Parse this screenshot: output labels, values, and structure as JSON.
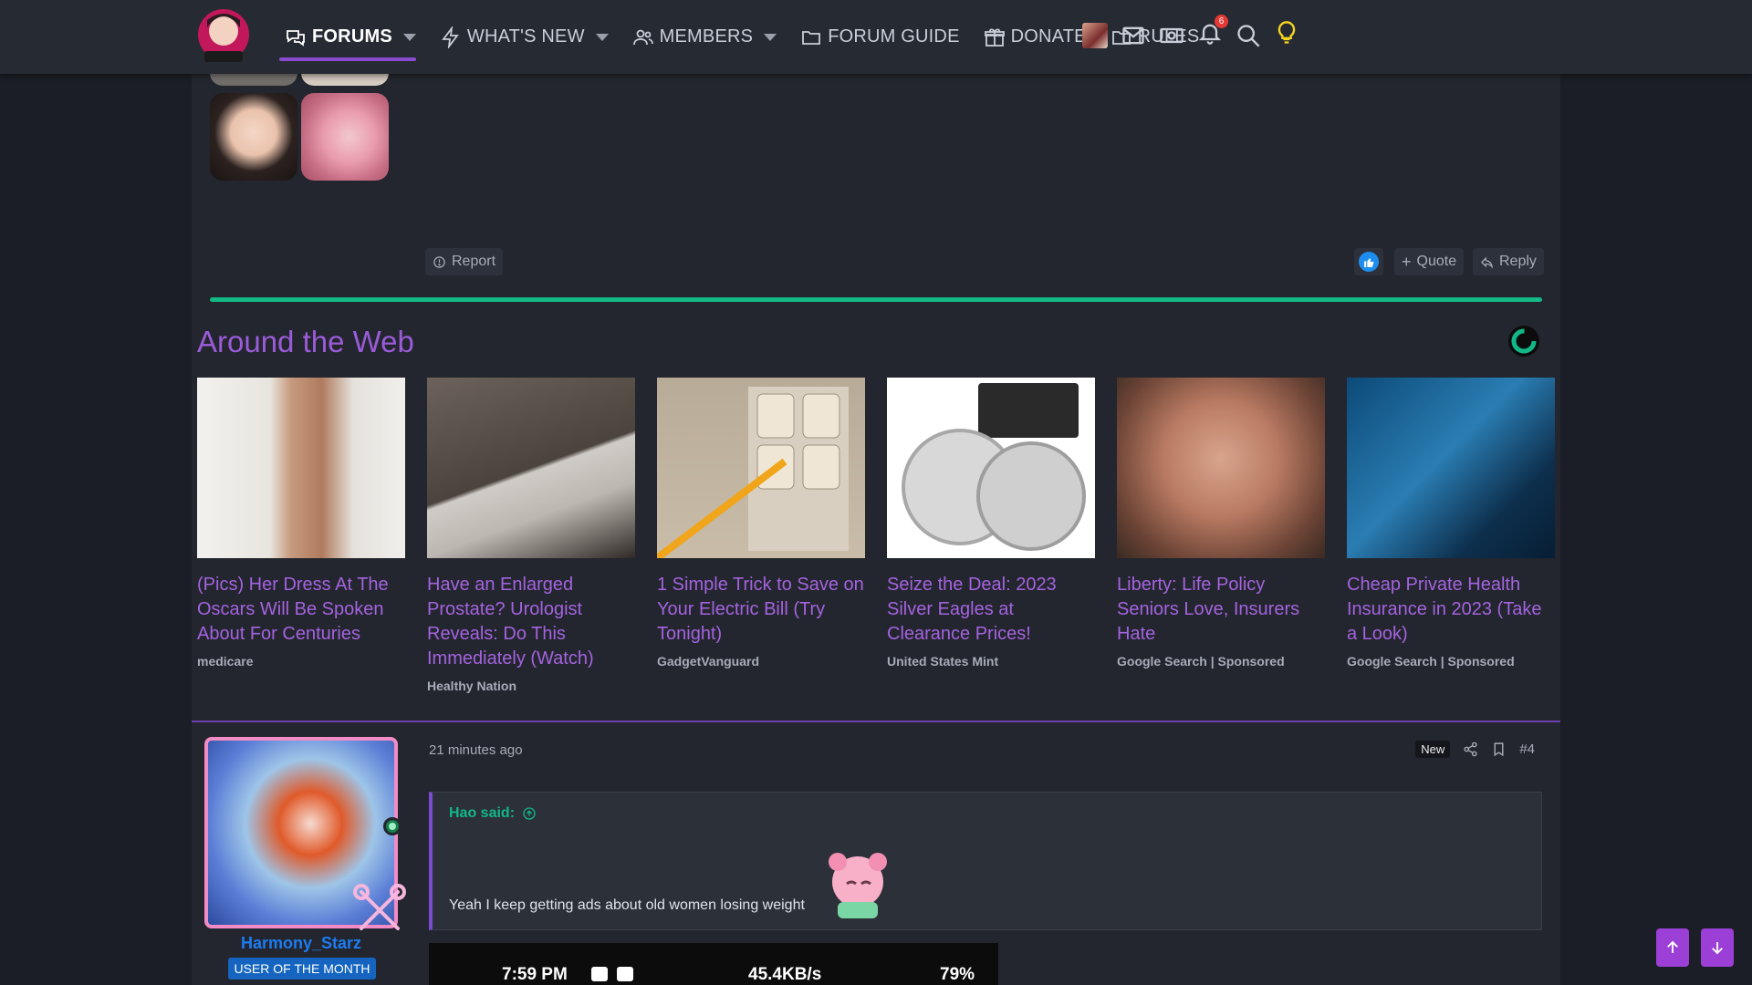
{
  "nav": {
    "items": [
      {
        "label": "FORUMS",
        "icon": "chat-icon",
        "active": true,
        "dropdown": true
      },
      {
        "label": "WHAT'S NEW",
        "icon": "bolt-icon",
        "active": false,
        "dropdown": true
      },
      {
        "label": "MEMBERS",
        "icon": "users-icon",
        "active": false,
        "dropdown": true
      },
      {
        "label": "FORUM GUIDE",
        "icon": "folder-icon",
        "active": false,
        "dropdown": false
      },
      {
        "label": "DONATE",
        "icon": "gift-icon",
        "active": false,
        "dropdown": false
      },
      {
        "label": "RULES",
        "icon": "folder-icon",
        "active": false,
        "dropdown": false
      }
    ],
    "notification_count": "6"
  },
  "post": {
    "report_label": "Report",
    "quote_label": "Quote",
    "reply_label": "Reply"
  },
  "around_the_web": {
    "title": "Around the Web",
    "ads": [
      {
        "title": "(Pics) Her Dress At The Oscars Will Be Spoken About For Centuries",
        "source": "medicare"
      },
      {
        "title": "Have an Enlarged Prostate? Urologist Reveals: Do This Immediately (Watch)",
        "source": "Healthy Nation"
      },
      {
        "title": "1 Simple Trick to Save on Your Electric Bill (Try Tonight)",
        "source": "GadgetVanguard"
      },
      {
        "title": "Seize the Deal: 2023 Silver Eagles at Clearance Prices!",
        "source": "United States Mint"
      },
      {
        "title": "Liberty: Life Policy Seniors Love, Insurers Hate",
        "source": "Google Search | Sponsored"
      },
      {
        "title": "Cheap Private Health Insurance in 2023 (Take a Look)",
        "source": "Google Search | Sponsored"
      }
    ]
  },
  "next_post": {
    "username": "Harmony_Starz",
    "user_title": "USER OF THE MONTH",
    "time": "21 minutes ago",
    "new_label": "New",
    "post_number": "#4",
    "quote_author": "Hao said:",
    "quote_text": "Yeah I keep getting ads about old women losing weight",
    "screenshot": {
      "time": "7:59 PM",
      "speed": "45.4KB/s",
      "battery": "79%"
    }
  },
  "colors": {
    "accent": "#9a5bd8",
    "green_bar": "#12b886",
    "background": "#1b1e26"
  }
}
